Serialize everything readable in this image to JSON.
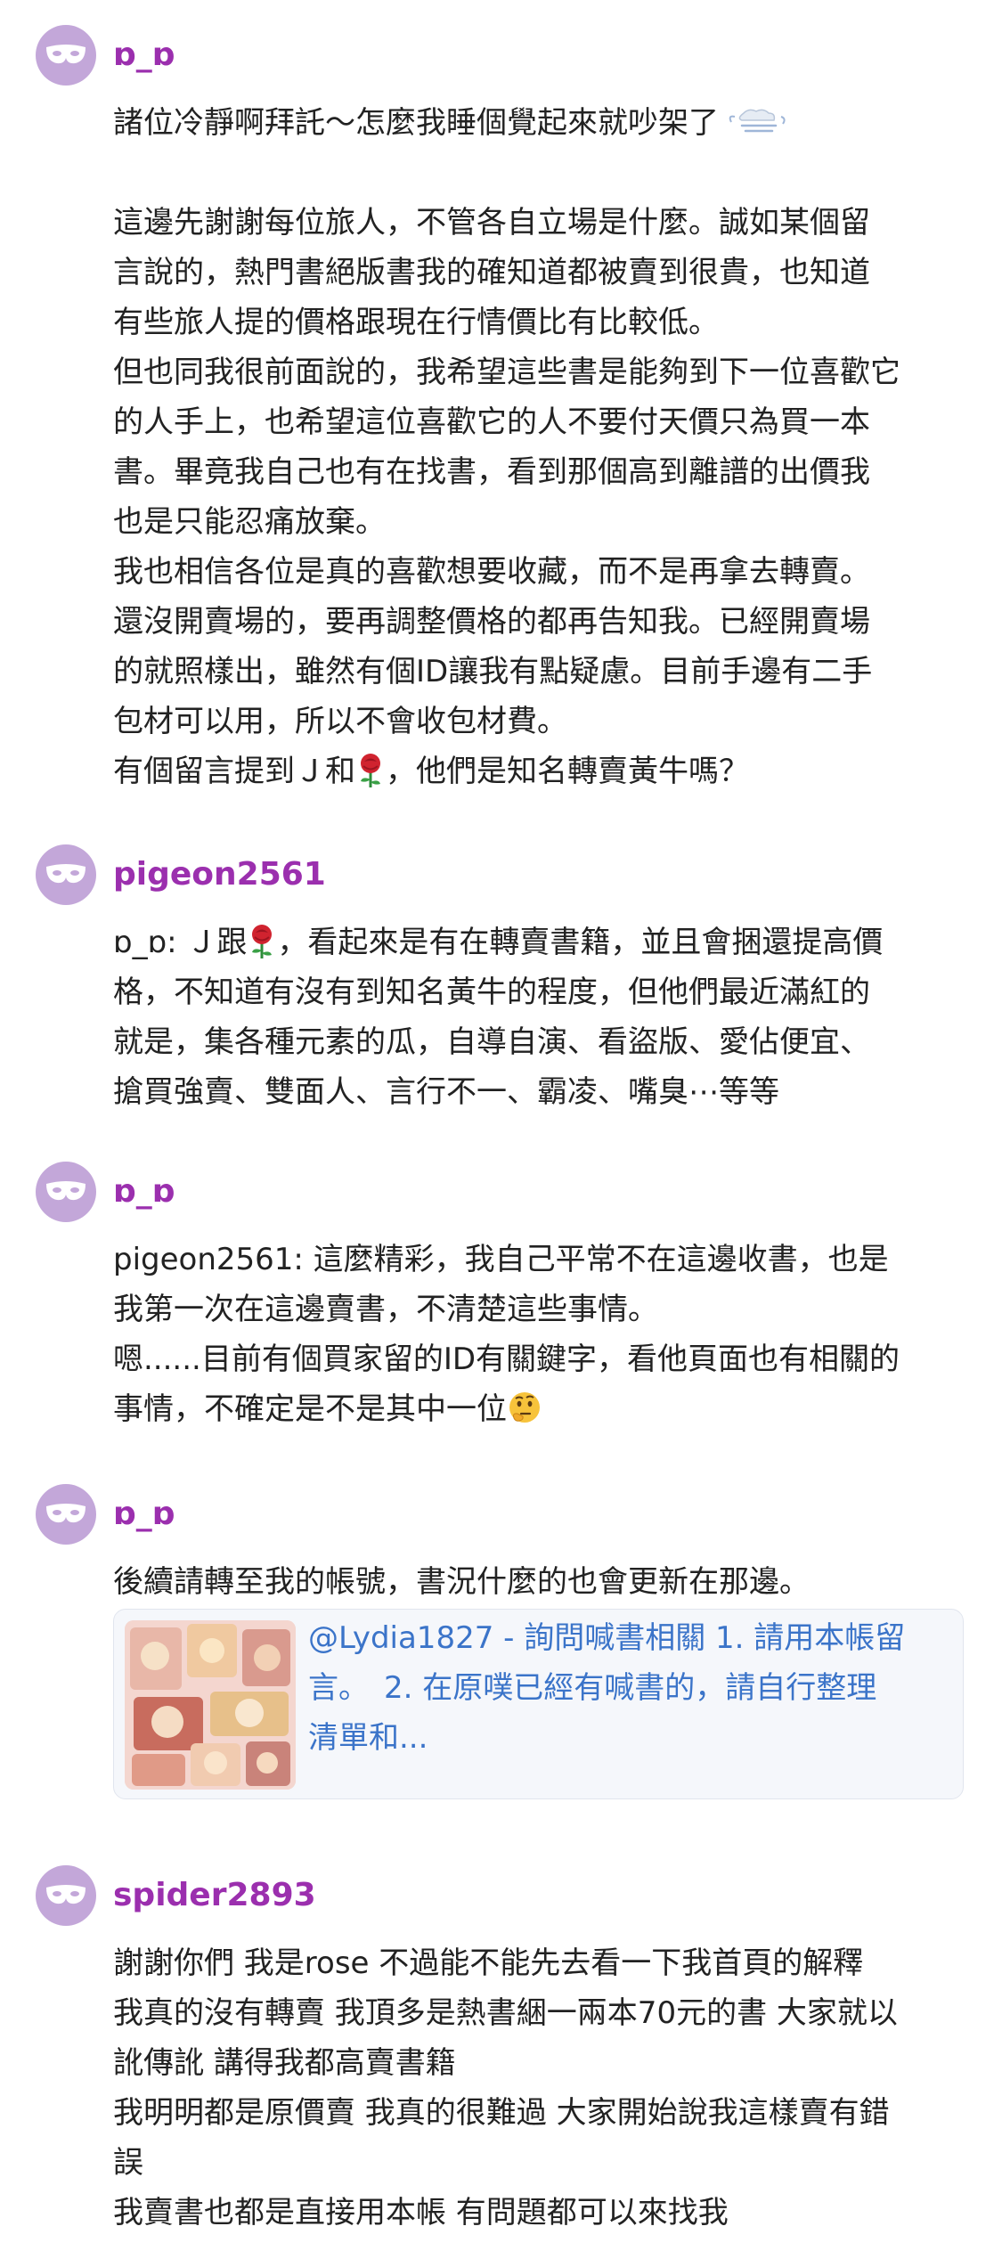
{
  "comments": [
    {
      "username": "ɒ_ɒ",
      "lines": [
        "諸位冷靜啊拜託～怎麼我睡個覺起來就吵架了",
        "",
        "這邊先謝謝每位旅人，不管各自立場是什麼。誠如某個留",
        "言說的，熱門書絕版書我的確知道都被賣到很貴，也知道",
        "有些旅人提的價格跟現在行情價比有比較低。",
        "但也同我很前面說的，我希望這些書是能夠到下一位喜歡它",
        "的人手上，也希望這位喜歡它的人不要付天價只為買一本",
        "書。畢竟我自己也有在找書，看到那個高到離譜的出價我",
        "也是只能忍痛放棄。",
        "我也相信各位是真的喜歡想要收藏，而不是再拿去轉賣。",
        "還沒開賣場的，要再調整價格的都再告知我。已經開賣場",
        "的就照樣出，雖然有個ID讓我有點疑慮。目前手邊有二手",
        "包材可以用，所以不會收包材費。"
      ],
      "rose_line": {
        "before": "有個留言提到Ｊ和",
        "after": "，他們是知名轉賣黃牛嗎？"
      }
    },
    {
      "username": "pigeon2561",
      "rose_line": {
        "before": "ɒ_ɒ: Ｊ跟",
        "after": "，看起來是有在轉賣書籍，並且會捆還提高價"
      },
      "lines": [
        "格，不知道有沒有到知名黃牛的程度，但他們最近滿紅的",
        "就是，集各種元素的瓜，自導自演、看盜版、愛佔便宜、",
        "搶買強賣、雙面人、言行不一、霸凌、嘴臭⋯等等"
      ]
    },
    {
      "username": "ɒ_ɒ",
      "lines": [
        "pigeon2561: 這麼精彩，我自己平常不在這邊收書，也是",
        "我第一次在這邊賣書，不清楚這些事情。",
        "嗯......目前有個買家留的ID有關鍵字，看他頁面也有相關的"
      ],
      "last_line": "事情，不確定是不是其中一位"
    },
    {
      "username": "ɒ_ɒ",
      "lines": [
        "後續請轉至我的帳號，書況什麼的也會更新在那邊。"
      ],
      "link_card": {
        "lines": [
          "@Lydia1827 - 詢問喊書相關 1. 請用本帳留",
          "言。　2. 在原噗已經有喊書的，請自行整理",
          "清單和..."
        ]
      }
    },
    {
      "username": "spider2893",
      "lines": [
        "謝謝你們 我是rose 不過能不能先去看一下我首頁的解釋",
        "我真的沒有轉賣 我頂多是熱書綑一兩本70元的書 大家就以",
        "訛傳訛 講得我都高賣書籍",
        "我明明都是原價賣 我真的很難過 大家開始說我這樣賣有錯",
        "誤",
        "我賣書也都是直接用本帳 有問題都可以來找我"
      ]
    }
  ],
  "colors": {
    "username": "#9b2fae",
    "avatar_bg": "#c3a7d9",
    "link_text": "#3b74c9",
    "card_bg": "#f5f7fb"
  },
  "icons": {
    "avatar": "mask-icon",
    "rose": "rose-emoji-icon",
    "thinking": "thinking-face-emoji-icon",
    "fog": "fog-emoji-icon"
  }
}
